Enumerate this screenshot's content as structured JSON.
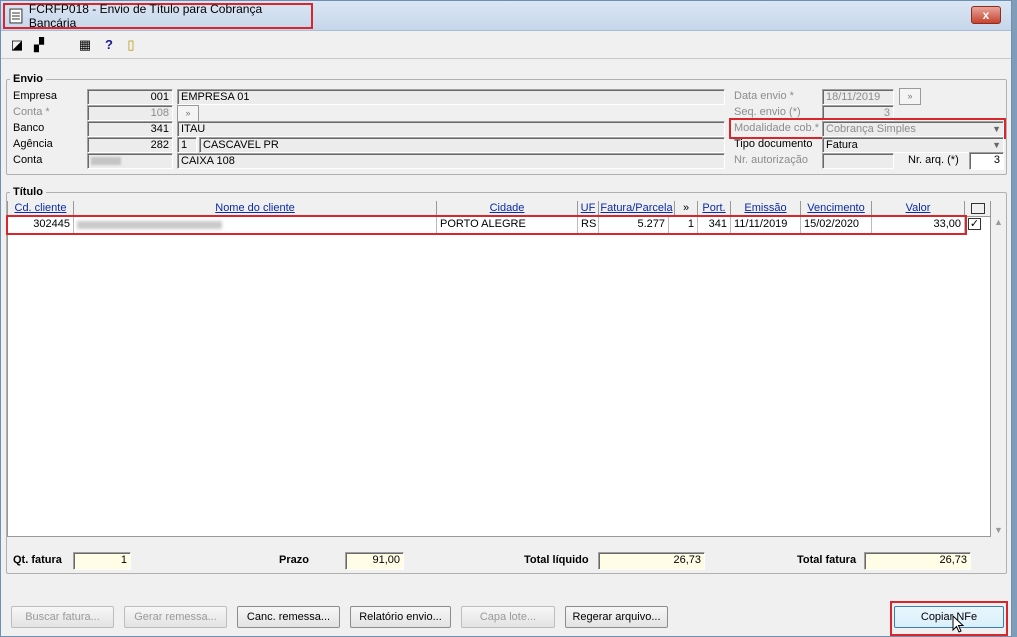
{
  "window": {
    "title": "FCRFP018 - Envio de Título para Cobrança Bancária",
    "close": "x"
  },
  "envio": {
    "label": "Envio",
    "empresa": {
      "label": "Empresa",
      "code": "001",
      "name": "EMPRESA 01"
    },
    "conta_ast": {
      "label": "Conta *",
      "code": "108"
    },
    "banco": {
      "label": "Banco",
      "code": "341",
      "name": "ITAU"
    },
    "agencia": {
      "label": "Agência",
      "code": "282",
      "digit": "1",
      "name": "CASCAVEL PR"
    },
    "conta": {
      "label": "Conta",
      "name": "CAIXA 108"
    },
    "data_envio": {
      "label": "Data envio *",
      "value": "18/11/2019"
    },
    "seq_envio": {
      "label": "Seq. envio (*)",
      "value": "3"
    },
    "modalidade": {
      "label": "Modalidade cob.*",
      "value": "Cobrança Simples"
    },
    "tipo_doc": {
      "label": "Tipo documento",
      "value": "Fatura"
    },
    "nr_autorizacao": {
      "label": "Nr. autorização"
    },
    "nr_arq": {
      "label": "Nr. arq. (*)",
      "value": "3"
    }
  },
  "titulo": {
    "label": "Título",
    "columns": [
      "Cd. cliente",
      "Nome do cliente",
      "Cidade",
      "UF",
      "Fatura/Parcela",
      "»",
      "Port.",
      "Emissão",
      "Vencimento",
      "Valor"
    ],
    "rows": [
      {
        "cd_cliente": "302445",
        "cidade": "PORTO ALEGRE",
        "uf": "RS",
        "fatura": "5.277",
        "parcela": "1",
        "port": "341",
        "emissao": "11/11/2019",
        "vencimento": "15/02/2020",
        "valor": "33,00"
      }
    ]
  },
  "totals": {
    "qt_fatura": {
      "label": "Qt. fatura",
      "value": "1"
    },
    "prazo": {
      "label": "Prazo",
      "value": "91,00"
    },
    "total_liquido": {
      "label": "Total líquido",
      "value": "26,73"
    },
    "total_fatura": {
      "label": "Total fatura",
      "value": "26,73"
    }
  },
  "buttons": {
    "buscar": "Buscar fatura...",
    "gerar": "Gerar remessa...",
    "canc": "Canc. remessa...",
    "relatorio": "Relatório envio...",
    "capa": "Capa lote...",
    "regerar": "Regerar arquivo...",
    "copiar": "Copiar NFe"
  },
  "colors": {
    "highlight": "#d9262c",
    "link_header": "#0a2aa8"
  }
}
